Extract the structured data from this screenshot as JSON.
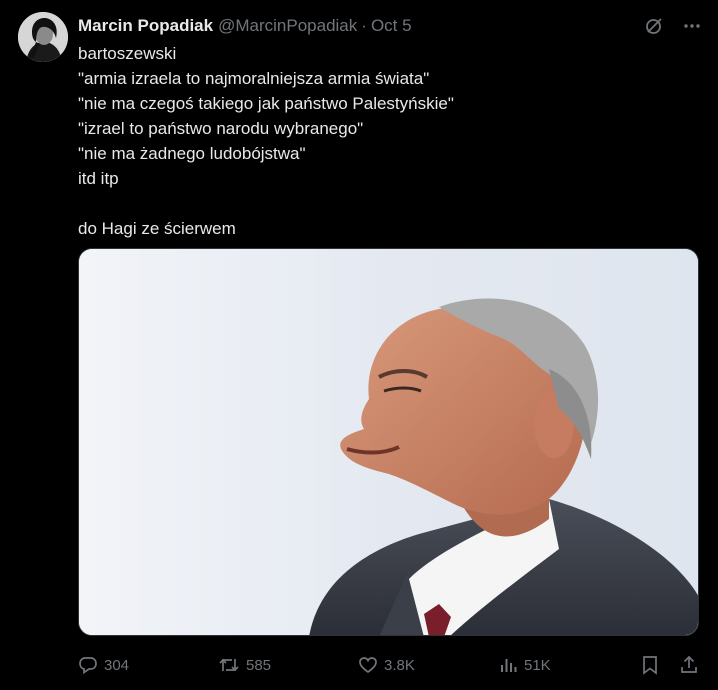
{
  "tweet": {
    "author": {
      "display_name": "Marcin Popadiak",
      "handle": "@MarcinPopadiak",
      "avatar_icon": "user-avatar"
    },
    "separator": "·",
    "date": "Oct 5",
    "text_lines": [
      "bartoszewski",
      "\"armia izraela to najmoralniejsza armia świata\"",
      "\"nie ma czegoś takiego jak państwo Palestyńskie\"",
      "\"izrael to państwo narodu wybranego\"",
      "\"nie ma żadnego ludobójstwa\"",
      "itd itp",
      "",
      "do Hagi ze ścierwem"
    ],
    "media": {
      "type": "photo",
      "description_icon": "photo-of-man-in-suit"
    },
    "actions": {
      "replies": "304",
      "reposts": "585",
      "likes": "3.8K",
      "views": "51K"
    },
    "colors": {
      "background": "#000000",
      "text_primary": "#e7e9ea",
      "text_secondary": "#71767b"
    }
  }
}
